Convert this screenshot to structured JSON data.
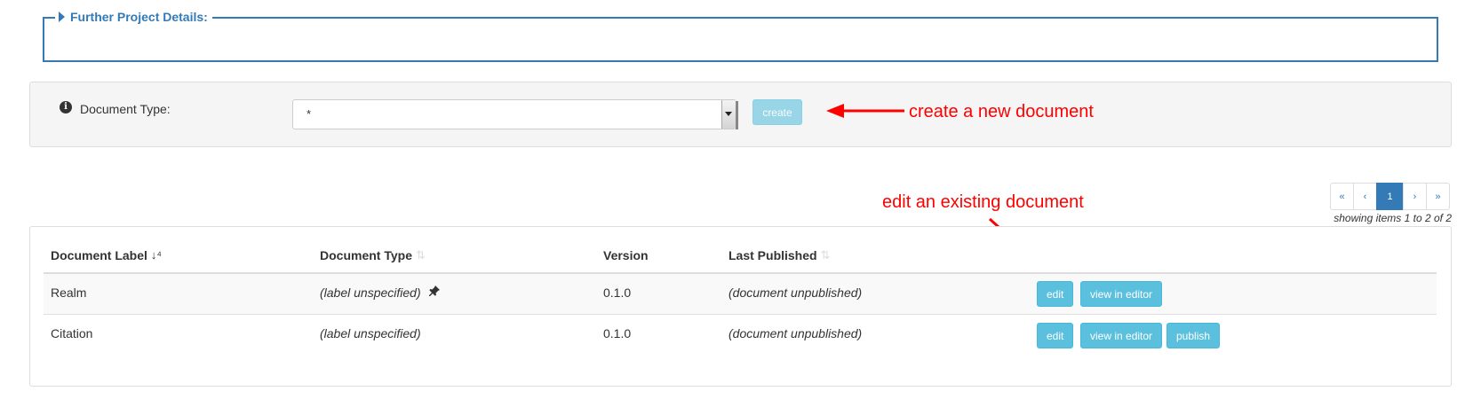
{
  "further_details": {
    "legend": "Further Project Details:"
  },
  "document_type": {
    "label": "Document Type:",
    "selected_value": "*",
    "create_label": "create"
  },
  "annotations": {
    "create": "create a new document",
    "edit": "edit an existing document"
  },
  "pagination": {
    "first": "«",
    "prev": "‹",
    "current": "1",
    "next": "›",
    "last": "»",
    "summary": "showing items 1 to 2 of 2"
  },
  "table": {
    "columns": {
      "label": "Document Label",
      "type": "Document Type",
      "version": "Version",
      "last_published": "Last Published"
    },
    "rows": [
      {
        "label": "Realm",
        "type": "(label unspecified)",
        "version": "0.1.0",
        "last_published": "(document unpublished)",
        "edit": "edit",
        "view": "view in editor"
      },
      {
        "label": "Citation",
        "type": "(label unspecified)",
        "version": "0.1.0",
        "last_published": "(document unpublished)",
        "edit": "edit",
        "view": "view in editor",
        "publish": "publish"
      }
    ]
  },
  "colors": {
    "primary": "#337ab7",
    "info_button": "#5bc0de",
    "annotation": "#ff0000",
    "panel_bg": "#f5f5f5"
  },
  "icons": {
    "legend_toggle": "caret-right-icon",
    "info": "info-circle-icon",
    "sort_label": "sort-alpha-asc-icon",
    "sort_inactive": "sort-icon",
    "row_pin": "pushpin-icon"
  }
}
